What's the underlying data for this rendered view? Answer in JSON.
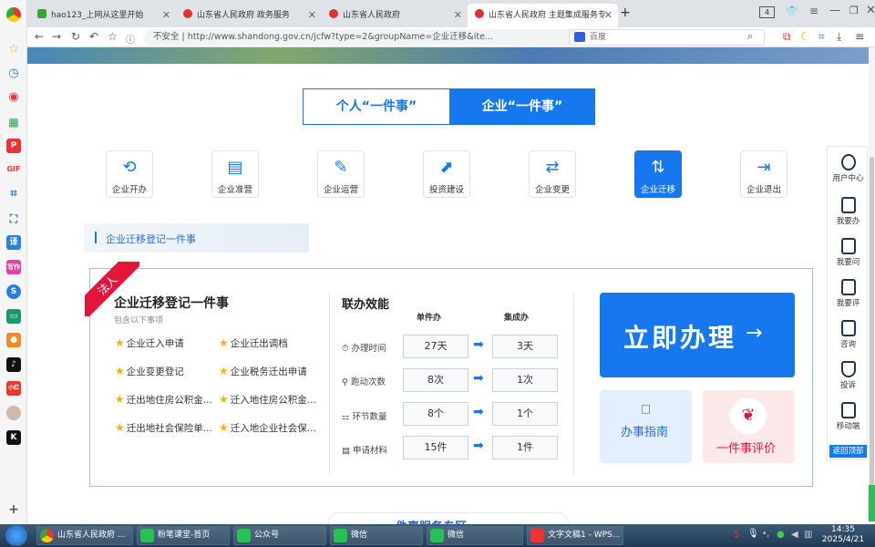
{
  "tabs": [
    {
      "label": "hao123_上网从这里开始"
    },
    {
      "label": "山东省人民政府 政务服务"
    },
    {
      "label": "山东省人民政府"
    },
    {
      "label": "山东省人民政府 主题集成服务专"
    }
  ],
  "tab_count": "4",
  "address": {
    "security": "不安全",
    "url": "http://www.shandong.gov.cn/jcfw?type=2&groupName=企业迁移&ite...",
    "search_engine": "百度"
  },
  "segment": {
    "personal": "个人“一件事”",
    "enterprise": "企业“一件事”"
  },
  "categories": [
    {
      "label": "企业开办"
    },
    {
      "label": "企业准营"
    },
    {
      "label": "企业运营"
    },
    {
      "label": "投资建设"
    },
    {
      "label": "企业变更"
    },
    {
      "label": "企业迁移"
    },
    {
      "label": "企业退出"
    }
  ],
  "sub_header": "企业迁移登记一件事",
  "card": {
    "ribbon": "法人",
    "title": "企业迁移登记一件事",
    "subtitle": "包含以下事项",
    "items": [
      "企业迁入申请",
      "企业迁出调档",
      "企业变更登记",
      "企业税务迁出申请",
      "迁出地住房公积金...",
      "迁入地住房公积金...",
      "迁出地社会保险单...",
      "迁入地企业社会保..."
    ],
    "effect_title": "联办效能",
    "col_single": "单件办",
    "col_integrated": "集成办",
    "rows": [
      {
        "label": "办理时间",
        "single": "27天",
        "integrated": "3天"
      },
      {
        "label": "跑动次数",
        "single": "8次",
        "integrated": "1次"
      },
      {
        "label": "环节数量",
        "single": "8个",
        "integrated": "1个"
      },
      {
        "label": "申请材料",
        "single": "15件",
        "integrated": "1件"
      }
    ],
    "go_label": "立即办理",
    "guide_label": "办事指南",
    "eval_label": "一件事评价"
  },
  "right_panel": [
    "用户中心",
    "我要办",
    "我要问",
    "我要评",
    "咨询",
    "投诉",
    "移动端"
  ],
  "back_top": "返回顶部",
  "bottom_partial": "一件事服务专区",
  "taskbar": [
    {
      "label": "山东省人民政府 ..."
    },
    {
      "label": "粉笔课堂-首页"
    },
    {
      "label": "公众号"
    },
    {
      "label": "微信"
    },
    {
      "label": "微信"
    },
    {
      "label": "文字文稿1 - WPS..."
    }
  ],
  "clock": {
    "time": "14:35",
    "date": "2025/4/21"
  },
  "colors": {
    "accent": "#1677ee",
    "ribbon": "#e3153a"
  }
}
